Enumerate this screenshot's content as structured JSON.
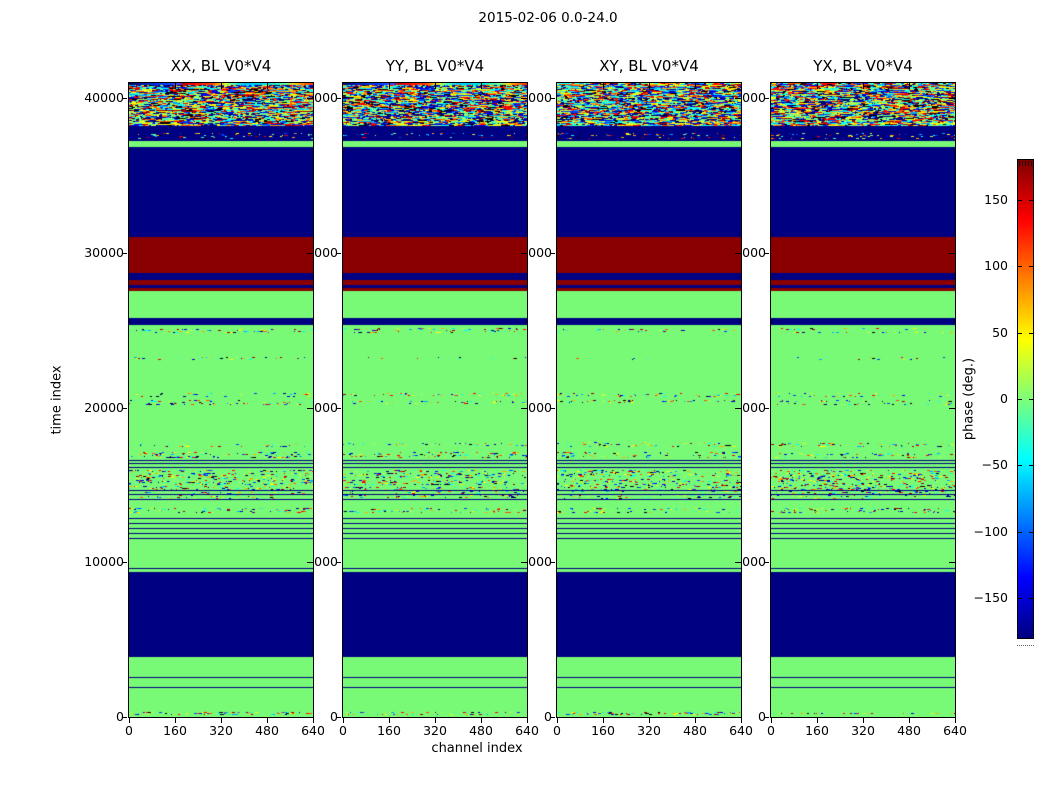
{
  "figure": {
    "title": "2015-02-06 0.0-24.0"
  },
  "chart_data": {
    "type": "heatmap",
    "title": "2015-02-06 0.0-24.0",
    "xlabel": "channel index",
    "ylabel": "time index",
    "x_ticks": [
      0,
      160,
      320,
      480,
      640
    ],
    "y_ticks": [
      0,
      10000,
      20000,
      30000,
      40000
    ],
    "x_range": [
      0,
      640
    ],
    "y_range": [
      0,
      41000
    ],
    "panels": [
      {
        "title": "XX, BL V0*V4",
        "top_row": "gradient"
      },
      {
        "title": "YY, BL V0*V4",
        "top_row": "gradient"
      },
      {
        "title": "XY, BL V0*V4",
        "top_row": "noise"
      },
      {
        "title": "YX, BL V0*V4",
        "top_row": "noise"
      }
    ],
    "colorbar": {
      "label": "phase (deg.)",
      "ticks": [
        150,
        100,
        50,
        0,
        -50,
        -100,
        -150
      ],
      "range": [
        -180,
        180
      ]
    },
    "phase_colors": {
      "navy": "#000082",
      "dark_red": "#8a0000",
      "green": "#79fa76",
      "navy_phase_deg": -180,
      "dark_red_phase_deg": 180,
      "green_phase_deg": 0
    },
    "bands": [
      {
        "t": [
          40740,
          41000
        ],
        "kind": "top"
      },
      {
        "t": [
          40000,
          40740
        ],
        "kind": "noise",
        "density": 1.0
      },
      {
        "t": [
          39580,
          40000
        ],
        "kind": "noise",
        "density": 0.85
      },
      {
        "t": [
          39060,
          39580
        ],
        "kind": "noise",
        "density": 1.0
      },
      {
        "t": [
          38540,
          39060
        ],
        "kind": "noise",
        "density": 0.8
      },
      {
        "t": [
          38190,
          38540
        ],
        "kind": "noise",
        "density": 1.0
      },
      {
        "t": [
          37740,
          38190
        ],
        "kind": "solid",
        "color": "navy"
      },
      {
        "t": [
          37380,
          37740
        ],
        "kind": "speckle",
        "bg": "navy",
        "density": 0.55
      },
      {
        "t": [
          37220,
          37380
        ],
        "kind": "solid",
        "color": "navy"
      },
      {
        "t": [
          36890,
          37220
        ],
        "kind": "solid",
        "color": "green"
      },
      {
        "t": [
          31040,
          36890
        ],
        "kind": "solid",
        "color": "navy"
      },
      {
        "t": [
          28710,
          31040
        ],
        "kind": "solid",
        "color": "dark_red"
      },
      {
        "t": [
          28260,
          28710
        ],
        "kind": "solid",
        "color": "navy"
      },
      {
        "t": [
          27940,
          28260
        ],
        "kind": "solid",
        "color": "dark_red"
      },
      {
        "t": [
          27750,
          27940
        ],
        "kind": "solid",
        "color": "navy"
      },
      {
        "t": [
          27550,
          27750
        ],
        "kind": "solid",
        "color": "dark_red"
      },
      {
        "t": [
          25800,
          27550
        ],
        "kind": "solid",
        "color": "green"
      },
      {
        "t": [
          25350,
          25800
        ],
        "kind": "solid",
        "color": "navy"
      },
      {
        "t": [
          25160,
          25350
        ],
        "kind": "solid",
        "color": "green"
      },
      {
        "t": [
          24830,
          25160
        ],
        "kind": "speckle",
        "bg": "green",
        "density": 0.5
      },
      {
        "t": [
          23280,
          24830
        ],
        "kind": "solid",
        "color": "green"
      },
      {
        "t": [
          23090,
          23280
        ],
        "kind": "speckle",
        "bg": "green",
        "density": 0.25
      },
      {
        "t": [
          20950,
          23090
        ],
        "kind": "solid",
        "color": "green"
      },
      {
        "t": [
          20690,
          20950
        ],
        "kind": "speckle",
        "bg": "green",
        "density": 0.5
      },
      {
        "t": [
          20490,
          20690
        ],
        "kind": "solid",
        "color": "green"
      },
      {
        "t": [
          20200,
          20490
        ],
        "kind": "speckle",
        "bg": "green",
        "density": 0.5
      },
      {
        "t": [
          17790,
          20200
        ],
        "kind": "solid",
        "color": "green"
      },
      {
        "t": [
          17460,
          17790
        ],
        "kind": "speckle",
        "bg": "green",
        "density": 0.45
      },
      {
        "t": [
          17140,
          17460
        ],
        "kind": "solid",
        "color": "green"
      },
      {
        "t": [
          16760,
          17140
        ],
        "kind": "speckle",
        "bg": "green",
        "density": 0.6
      },
      {
        "t": [
          16620,
          16760
        ],
        "kind": "solid",
        "color": "green"
      },
      {
        "t": [
          16560,
          16620
        ],
        "kind": "solid",
        "color": "navy"
      },
      {
        "t": [
          16420,
          16560
        ],
        "kind": "solid",
        "color": "green"
      },
      {
        "t": [
          16360,
          16420
        ],
        "kind": "solid",
        "color": "navy"
      },
      {
        "t": [
          16160,
          16360
        ],
        "kind": "solid",
        "color": "green"
      },
      {
        "t": [
          16100,
          16160
        ],
        "kind": "solid",
        "color": "navy"
      },
      {
        "t": [
          15980,
          16100
        ],
        "kind": "solid",
        "color": "green"
      },
      {
        "t": [
          14680,
          15980
        ],
        "kind": "speckle",
        "bg": "green",
        "density": 0.8
      },
      {
        "t": [
          14620,
          14680
        ],
        "kind": "solid",
        "color": "navy"
      },
      {
        "t": [
          14400,
          14620
        ],
        "kind": "speckle",
        "bg": "green",
        "density": 0.5
      },
      {
        "t": [
          14340,
          14400
        ],
        "kind": "solid",
        "color": "navy"
      },
      {
        "t": [
          14110,
          14340
        ],
        "kind": "speckle",
        "bg": "green",
        "density": 0.4
      },
      {
        "t": [
          14050,
          14110
        ],
        "kind": "solid",
        "color": "navy"
      },
      {
        "t": [
          13520,
          14050
        ],
        "kind": "solid",
        "color": "green"
      },
      {
        "t": [
          13190,
          13520
        ],
        "kind": "speckle",
        "bg": "green",
        "density": 0.55
      },
      {
        "t": [
          12870,
          13190
        ],
        "kind": "solid",
        "color": "green"
      },
      {
        "t": [
          12810,
          12870
        ],
        "kind": "solid",
        "color": "navy"
      },
      {
        "t": [
          12550,
          12810
        ],
        "kind": "solid",
        "color": "green"
      },
      {
        "t": [
          12490,
          12550
        ],
        "kind": "solid",
        "color": "navy"
      },
      {
        "t": [
          12220,
          12490
        ],
        "kind": "solid",
        "color": "green"
      },
      {
        "t": [
          12160,
          12220
        ],
        "kind": "solid",
        "color": "navy"
      },
      {
        "t": [
          11900,
          12160
        ],
        "kind": "solid",
        "color": "green"
      },
      {
        "t": [
          11840,
          11900
        ],
        "kind": "solid",
        "color": "navy"
      },
      {
        "t": [
          11580,
          11840
        ],
        "kind": "solid",
        "color": "green"
      },
      {
        "t": [
          11520,
          11580
        ],
        "kind": "solid",
        "color": "navy"
      },
      {
        "t": [
          9650,
          11520
        ],
        "kind": "solid",
        "color": "green"
      },
      {
        "t": [
          9590,
          9650
        ],
        "kind": "solid",
        "color": "navy"
      },
      {
        "t": [
          9380,
          9590
        ],
        "kind": "solid",
        "color": "green"
      },
      {
        "t": [
          3880,
          9380
        ],
        "kind": "solid",
        "color": "navy"
      },
      {
        "t": [
          2590,
          3880
        ],
        "kind": "solid",
        "color": "green"
      },
      {
        "t": [
          2530,
          2590
        ],
        "kind": "solid",
        "color": "navy"
      },
      {
        "t": [
          1940,
          2530
        ],
        "kind": "solid",
        "color": "green"
      },
      {
        "t": [
          1880,
          1940
        ],
        "kind": "solid",
        "color": "navy"
      },
      {
        "t": [
          330,
          1880
        ],
        "kind": "solid",
        "color": "green"
      },
      {
        "t": [
          100,
          330
        ],
        "kind": "speckle",
        "bg": "green",
        "density": 0.85
      },
      {
        "t": [
          0,
          100
        ],
        "kind": "solid",
        "color": "green"
      }
    ]
  }
}
